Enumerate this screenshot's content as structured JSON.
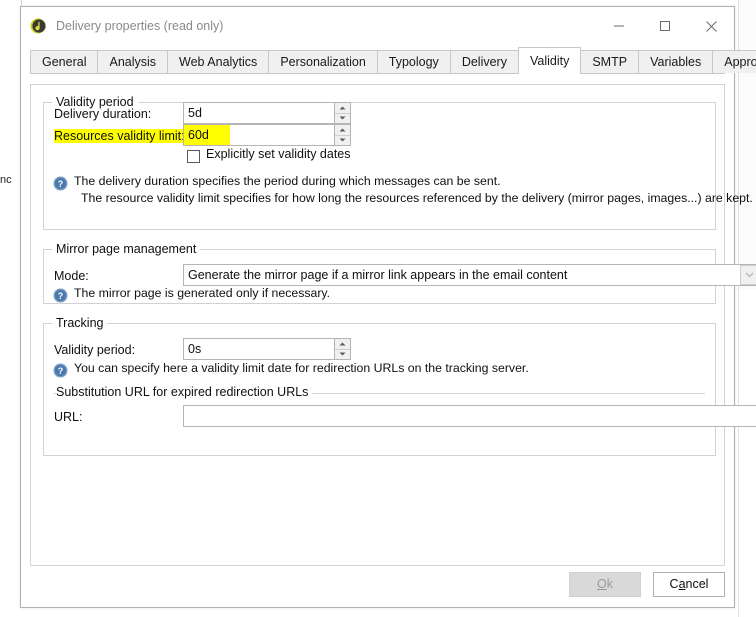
{
  "window": {
    "title": "Delivery properties (read only)",
    "icon": "adobe-campaign-icon",
    "controls": {
      "minimize": "—",
      "maximize": "□",
      "close": "×"
    }
  },
  "background": {
    "left_fragment_text": "nc"
  },
  "tabs": {
    "items": [
      {
        "label": "General",
        "selected": false
      },
      {
        "label": "Analysis",
        "selected": false
      },
      {
        "label": "Web Analytics",
        "selected": false
      },
      {
        "label": "Personalization",
        "selected": false
      },
      {
        "label": "Typology",
        "selected": false
      },
      {
        "label": "Delivery",
        "selected": false
      },
      {
        "label": "Validity",
        "selected": true
      },
      {
        "label": "SMTP",
        "selected": false
      },
      {
        "label": "Variables",
        "selected": false
      },
      {
        "label": "Approvals",
        "selected": false
      }
    ],
    "scroll_left": "◀",
    "scroll_right": "▶"
  },
  "validity_period": {
    "legend": "Validity period",
    "delivery_duration": {
      "label": "Delivery duration:",
      "value": "5d"
    },
    "resources_validity_limit": {
      "label": "Resources validity limit:",
      "value": "60d",
      "highlight_color": "#ffff00"
    },
    "explicit_dates": {
      "label": "Explicitly set validity dates",
      "checked": false
    },
    "info_line_1": "The delivery duration specifies the period during which messages can be sent.",
    "info_line_2": "The resource validity limit specifies for how long the resources referenced by the delivery (mirror pages, images...) are kept."
  },
  "mirror_page": {
    "legend": "Mirror page management",
    "mode": {
      "label": "Mode:",
      "value": "Generate the mirror page if a mirror link appears in the email content",
      "options": [
        "Generate the mirror page if a mirror link appears in the email content"
      ]
    },
    "info": "The mirror page is generated only if necessary."
  },
  "tracking": {
    "legend": "Tracking",
    "validity_period": {
      "label": "Validity period:",
      "value": "0s"
    },
    "info": "You can specify here a validity limit date for redirection URLs on the tracking server.",
    "substitution": {
      "caption": "Substitution URL for expired redirection URLs",
      "url_label": "URL:",
      "url_value": "",
      "url_placeholder": ""
    }
  },
  "footer": {
    "ok_label": "Ok",
    "ok_accelerator": "O",
    "ok_enabled": false,
    "cancel_label": "Cancel",
    "cancel_accelerator": "a"
  }
}
